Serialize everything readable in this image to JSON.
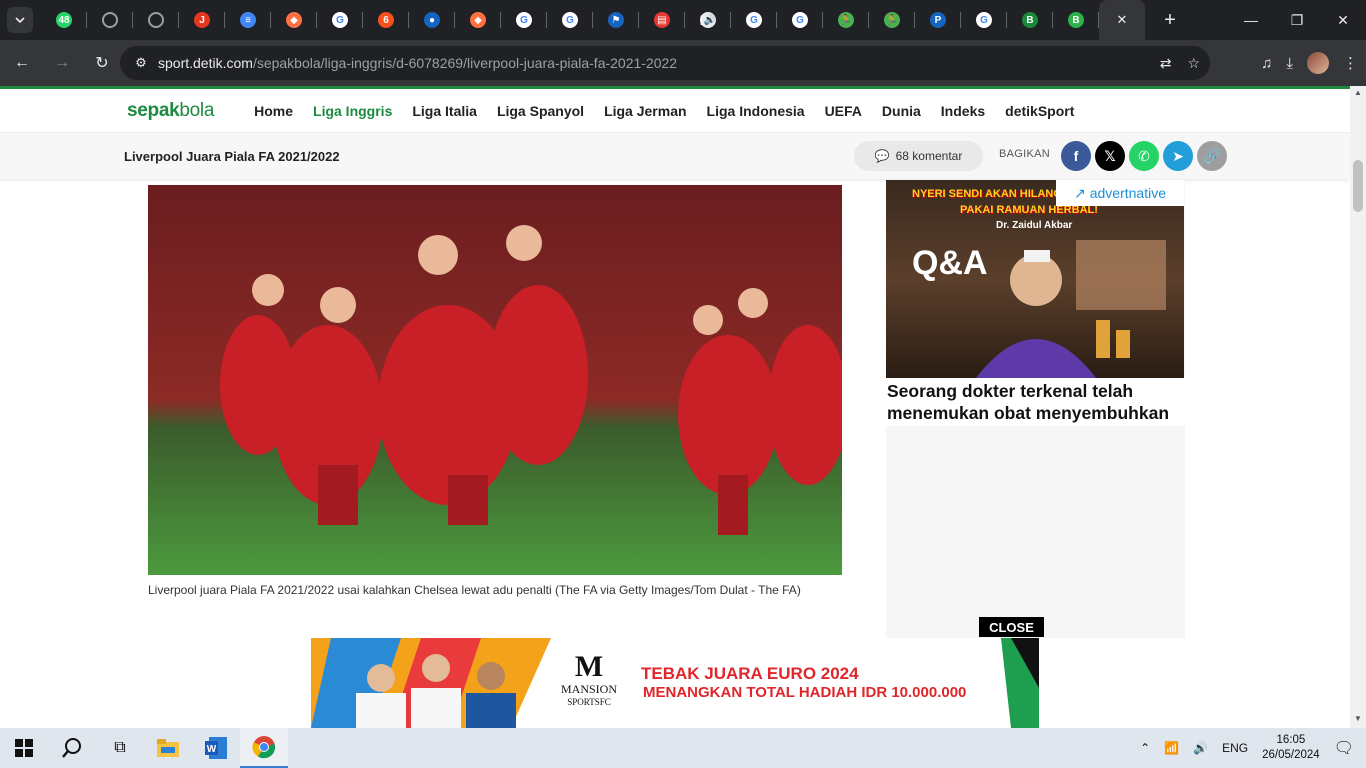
{
  "browser": {
    "tabs": [
      {
        "icon": "whatsapp-icon",
        "color": "#25d366",
        "glyph": "48"
      },
      {
        "icon": "globe-icon",
        "color": "#5f6368",
        "glyph": ""
      },
      {
        "icon": "globe-icon",
        "color": "#5f6368",
        "glyph": ""
      },
      {
        "icon": "jbl-icon",
        "color": "#e3371e",
        "glyph": "J"
      },
      {
        "icon": "docs-icon",
        "color": "#4285f4",
        "glyph": "≡"
      },
      {
        "icon": "app-icon",
        "color": "#ff7043",
        "glyph": "◆"
      },
      {
        "icon": "google-icon",
        "color": "#ffffff",
        "glyph": "G"
      },
      {
        "icon": "six-icon",
        "color": "#f4511e",
        "glyph": "6"
      },
      {
        "icon": "pepsi-icon",
        "color": "#1565c0",
        "glyph": "●"
      },
      {
        "icon": "app-icon",
        "color": "#ff7043",
        "glyph": "◆"
      },
      {
        "icon": "google-icon",
        "color": "#ffffff",
        "glyph": "G"
      },
      {
        "icon": "google-icon",
        "color": "#ffffff",
        "glyph": "G"
      },
      {
        "icon": "flag-icon",
        "color": "#1565c0",
        "glyph": "⚑"
      },
      {
        "icon": "media-icon",
        "color": "#e53935",
        "glyph": "▤"
      },
      {
        "icon": "sound-icon",
        "color": "#e8eaed",
        "glyph": "[🔊"
      },
      {
        "icon": "google-icon",
        "color": "#ffffff",
        "glyph": "G"
      },
      {
        "icon": "google-icon",
        "color": "#ffffff",
        "glyph": "G"
      },
      {
        "icon": "run-icon",
        "color": "#4caf50",
        "glyph": "🏃"
      },
      {
        "icon": "run-icon",
        "color": "#4caf50",
        "glyph": "🏃"
      },
      {
        "icon": "p-icon",
        "color": "#1565c0",
        "glyph": "P"
      },
      {
        "icon": "google-icon",
        "color": "#ffffff",
        "glyph": "G"
      },
      {
        "icon": "b-icon",
        "color": "#1b8a3a",
        "glyph": "B"
      },
      {
        "icon": "b-icon",
        "color": "#2bb34a",
        "glyph": "B"
      }
    ],
    "url_host": "sport.detik.com",
    "url_path": "/sepakbola/liga-inggris/d-6078269/liverpool-juara-piala-fa-2021-2022"
  },
  "site": {
    "logo_main": "sepak",
    "logo_sub": "bola",
    "nav": [
      {
        "label": "Home",
        "active": false
      },
      {
        "label": "Liga Inggris",
        "active": true
      },
      {
        "label": "Liga Italia",
        "active": false
      },
      {
        "label": "Liga Spanyol",
        "active": false
      },
      {
        "label": "Liga Jerman",
        "active": false
      },
      {
        "label": "Liga Indonesia",
        "active": false
      },
      {
        "label": "UEFA",
        "active": false
      },
      {
        "label": "Dunia",
        "active": false
      },
      {
        "label": "Indeks",
        "active": false
      },
      {
        "label": "detikSport",
        "active": false
      }
    ],
    "article_title": "Liverpool Juara Piala FA 2021/2022",
    "comments": "68 komentar",
    "share_label": "BAGIKAN",
    "shares": [
      {
        "name": "facebook-share-button",
        "color": "#3b5998",
        "glyph": "f"
      },
      {
        "name": "x-share-button",
        "color": "#000000",
        "glyph": "𝕏"
      },
      {
        "name": "whatsapp-share-button",
        "color": "#25d366",
        "glyph": "✆"
      },
      {
        "name": "telegram-share-button",
        "color": "#229ed9",
        "glyph": "➤"
      },
      {
        "name": "copy-link-button",
        "color": "#9e9e9e",
        "glyph": "🔗"
      }
    ],
    "photo_caption": "Liverpool juara Piala FA 2021/2022 usai kalahkan Chelsea lewat adu penalti (The FA via Getty Images/Tom Dulat - The FA)"
  },
  "ad": {
    "headline_top": "NYERI SENDI AKAN HILANG",
    "headline_bottom": "PAKAI RAMUAN HERBAL!",
    "doctor": "Dr. Zaidul Akbar",
    "qa": "Q&A",
    "network": "advertnative",
    "text": "Seorang dokter terkenal telah menemukan obat menyembuhkan",
    "close": "CLOSE"
  },
  "banner": {
    "brand": "MANSION",
    "brand_sub": "SPORTSFC",
    "line1": "TEBAK JUARA EURO 2024",
    "line2": "MENANGKAN TOTAL HADIAH IDR 10.000.000"
  },
  "taskbar": {
    "lang": "ENG",
    "time": "16:05",
    "date": "26/05/2024"
  }
}
